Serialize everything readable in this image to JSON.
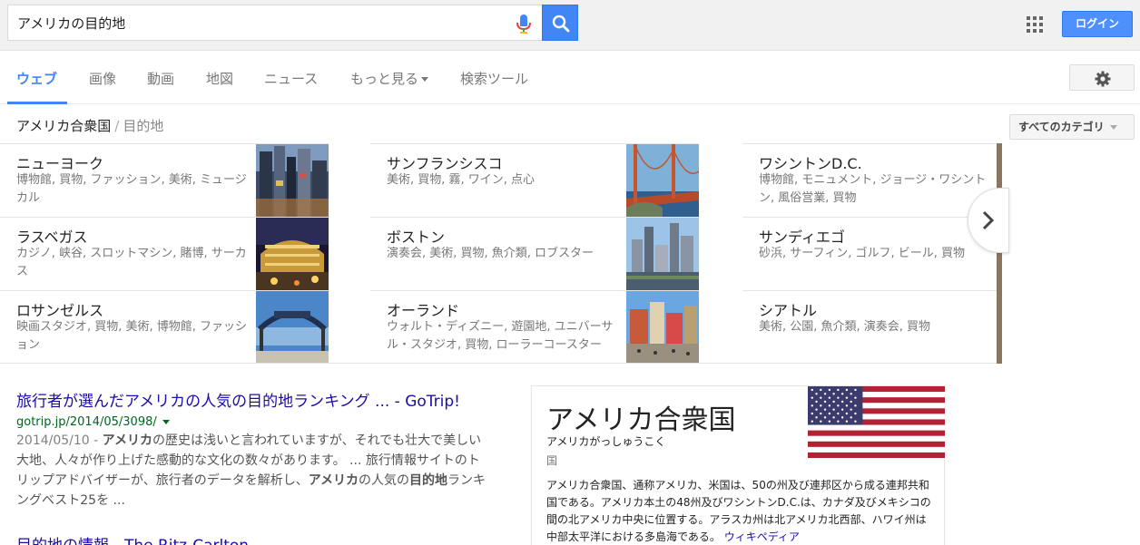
{
  "search": {
    "query": "アメリカの目的地"
  },
  "header": {
    "login_label": "ログイン"
  },
  "tabs": [
    {
      "label": "ウェブ",
      "active": true
    },
    {
      "label": "画像"
    },
    {
      "label": "動画"
    },
    {
      "label": "地図"
    },
    {
      "label": "ニュース"
    },
    {
      "label": "もっと見る"
    },
    {
      "label": "検索ツール"
    }
  ],
  "breadcrumb": {
    "root": "アメリカ合衆国",
    "separator": "/",
    "current": "目的地"
  },
  "category_filter": {
    "label": "すべてのカテゴリ"
  },
  "destinations": [
    {
      "name": "ニューヨーク",
      "desc": "博物館, 買物, ファッション, 美術, ミュージカル"
    },
    {
      "name": "サンフランシスコ",
      "desc": "美術, 買物, 霧, ワイン, 点心"
    },
    {
      "name": "ワシントンD.C.",
      "desc": "博物館, モニュメント, ジョージ・ワシントン, 風俗営業, 買物"
    },
    {
      "name": "ラスベガス",
      "desc": "カジノ, 峡谷, スロットマシン, 賭博, サーカス"
    },
    {
      "name": "ボストン",
      "desc": "演奏会, 美術, 買物, 魚介類, ロブスター"
    },
    {
      "name": "サンディエゴ",
      "desc": "砂浜, サーフィン, ゴルフ, ビール, 買物"
    },
    {
      "name": "ロサンゼルス",
      "desc": "映画スタジオ, 買物, 美術, 博物館, ファッション"
    },
    {
      "name": "オーランド",
      "desc": "ウォルト・ディズニー, 遊園地, ユニバーサル・スタジオ, 買物, ローラーコースター"
    },
    {
      "name": "シアトル",
      "desc": "美術, 公園, 魚介類, 演奏会, 買物"
    }
  ],
  "results": [
    {
      "title": "旅行者が選んだアメリカの人気の目的地ランキング ... - GoTrip!",
      "url": "gotrip.jp/2014/05/3098/",
      "date": "2014/05/10 - ",
      "s1": "アメリカ",
      "s2": "の歴史は浅いと言われていますが、それでも壮大で美しい大地、人々が作り上げた感動的な文化の数々があります。 ... 旅行情報サイトのトリップアドバイザーが、旅行者のデータを解析し、",
      "s3": "アメリカ",
      "s4": "の人気の",
      "s5": "目的地",
      "s6": "ランキングベスト25を ..."
    },
    {
      "title": "目的地の情報 - The Ritz-Carlton"
    }
  ],
  "knowledge_panel": {
    "title": "アメリカ合衆国",
    "reading": "アメリカがっしゅうこく",
    "type": "国",
    "description": "アメリカ合衆国、通称アメリカ、米国は、50の州及び連邦区から成る連邦共和国である。アメリカ本土の48州及びワシントンD.C.は、カナダ及びメキシコの間の北アメリカ中央に位置する。アラスカ州は北アメリカ北西部、ハワイ州は中部太平洋における多島海である。",
    "source": "ウィキペディア"
  },
  "colors": {
    "accent": "#4285f4",
    "link": "#1a0dab",
    "url": "#006621"
  }
}
